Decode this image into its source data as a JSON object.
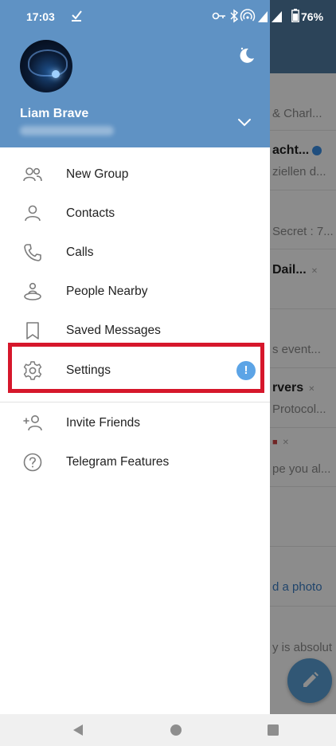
{
  "status_bar": {
    "time": "17:03",
    "battery": "76%"
  },
  "drawer": {
    "user_name": "Liam Brave",
    "menu": [
      {
        "id": "new-group",
        "label": "New Group",
        "icon": "group-icon"
      },
      {
        "id": "contacts",
        "label": "Contacts",
        "icon": "person-icon"
      },
      {
        "id": "calls",
        "label": "Calls",
        "icon": "phone-icon"
      },
      {
        "id": "people-nearby",
        "label": "People Nearby",
        "icon": "people-nearby-icon"
      },
      {
        "id": "saved-messages",
        "label": "Saved Messages",
        "icon": "bookmark-icon"
      },
      {
        "id": "settings",
        "label": "Settings",
        "icon": "gear-icon",
        "badge": "!"
      },
      {
        "id": "invite-friends",
        "label": "Invite Friends",
        "icon": "add-person-icon"
      },
      {
        "id": "telegram-features",
        "label": "Telegram Features",
        "icon": "question-icon"
      }
    ]
  },
  "background_chats": [
    "& Charl...",
    "acht...",
    "ziellen d...",
    "Secret : 7...",
    "Dail...",
    "s event...",
    "rvers",
    "Protocol...",
    "pe you al...",
    "d a photo",
    "y is absolut"
  ],
  "colors": {
    "header": "#5f92c4",
    "accent": "#5ca4e6",
    "highlight": "#d6172b"
  }
}
